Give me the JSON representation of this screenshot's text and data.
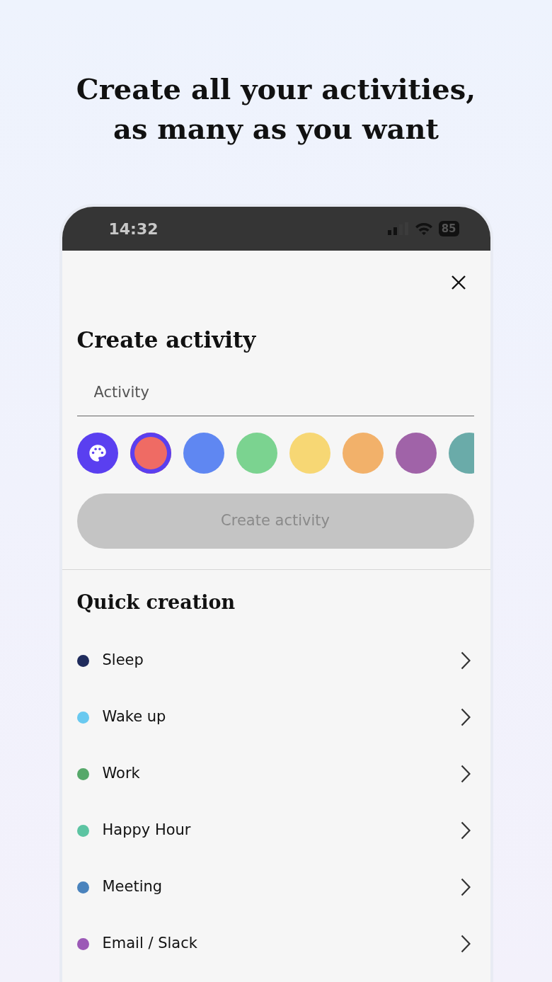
{
  "headline": "Create all your activities, as many as you want",
  "status_bar": {
    "time": "14:32",
    "battery": "85"
  },
  "dialog": {
    "title": "Create activity",
    "activity_field": {
      "placeholder": "Activity"
    },
    "swatches": [
      {
        "color": "#ef6b64",
        "selected": true
      },
      {
        "color": "#5f87f2",
        "selected": false
      },
      {
        "color": "#7bd390",
        "selected": false
      },
      {
        "color": "#f7d774",
        "selected": false
      },
      {
        "color": "#f2b16a",
        "selected": false
      },
      {
        "color": "#a063a8",
        "selected": false
      },
      {
        "color": "#6aaba9",
        "selected": false
      }
    ],
    "create_button": {
      "label": "Create activity",
      "disabled": true
    }
  },
  "quick_creation": {
    "title": "Quick creation",
    "items": [
      {
        "label": "Sleep",
        "color": "#1f2b5c"
      },
      {
        "label": "Wake up",
        "color": "#69c9f0"
      },
      {
        "label": "Work",
        "color": "#56a86a"
      },
      {
        "label": "Happy Hour",
        "color": "#5cc4a2"
      },
      {
        "label": "Meeting",
        "color": "#4a83bd"
      },
      {
        "label": "Email / Slack",
        "color": "#9b59b6"
      }
    ]
  }
}
